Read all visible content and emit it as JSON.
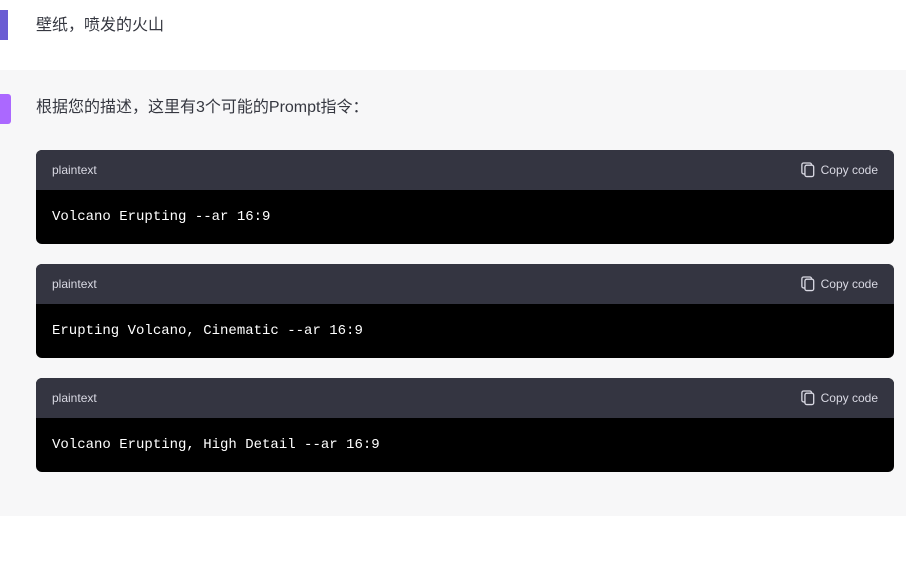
{
  "user": {
    "message": "壁纸，喷发的火山"
  },
  "assistant": {
    "intro": "根据您的描述，这里有3个可能的Prompt指令：",
    "code_blocks": [
      {
        "lang": "plaintext",
        "copy_label": "Copy code",
        "content": "Volcano Erupting --ar 16:9"
      },
      {
        "lang": "plaintext",
        "copy_label": "Copy code",
        "content": "Erupting Volcano, Cinematic --ar 16:9"
      },
      {
        "lang": "plaintext",
        "copy_label": "Copy code",
        "content": "Volcano Erupting, High Detail --ar 16:9"
      }
    ]
  }
}
